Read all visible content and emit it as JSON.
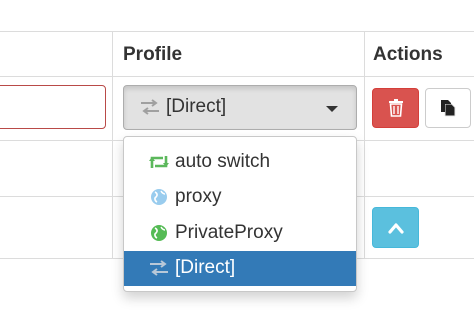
{
  "table": {
    "headers": {
      "profile": "Profile",
      "actions": "Actions"
    }
  },
  "row1": {
    "profile_select": {
      "value": "[Direct]",
      "icon": "transfer-icon"
    },
    "actions": {
      "delete": {
        "icon": "trash-icon",
        "color": "#d9534f"
      },
      "duplicate": {
        "icon": "copy-icon"
      }
    }
  },
  "row2": {
    "actions": {
      "move_up": {
        "icon": "chevron-up-icon",
        "color": "#5bc0de"
      }
    }
  },
  "dropdown": {
    "items": [
      {
        "label": "auto switch",
        "icon": "retweet-icon",
        "color": "#5cb85c"
      },
      {
        "label": "proxy",
        "icon": "globe-icon",
        "color": "#99ccee"
      },
      {
        "label": "PrivateProxy",
        "icon": "globe-icon",
        "color": "#55bb55"
      },
      {
        "label": "[Direct]",
        "icon": "transfer-icon",
        "selected": true
      }
    ],
    "highlight_color": "#337ab7"
  }
}
